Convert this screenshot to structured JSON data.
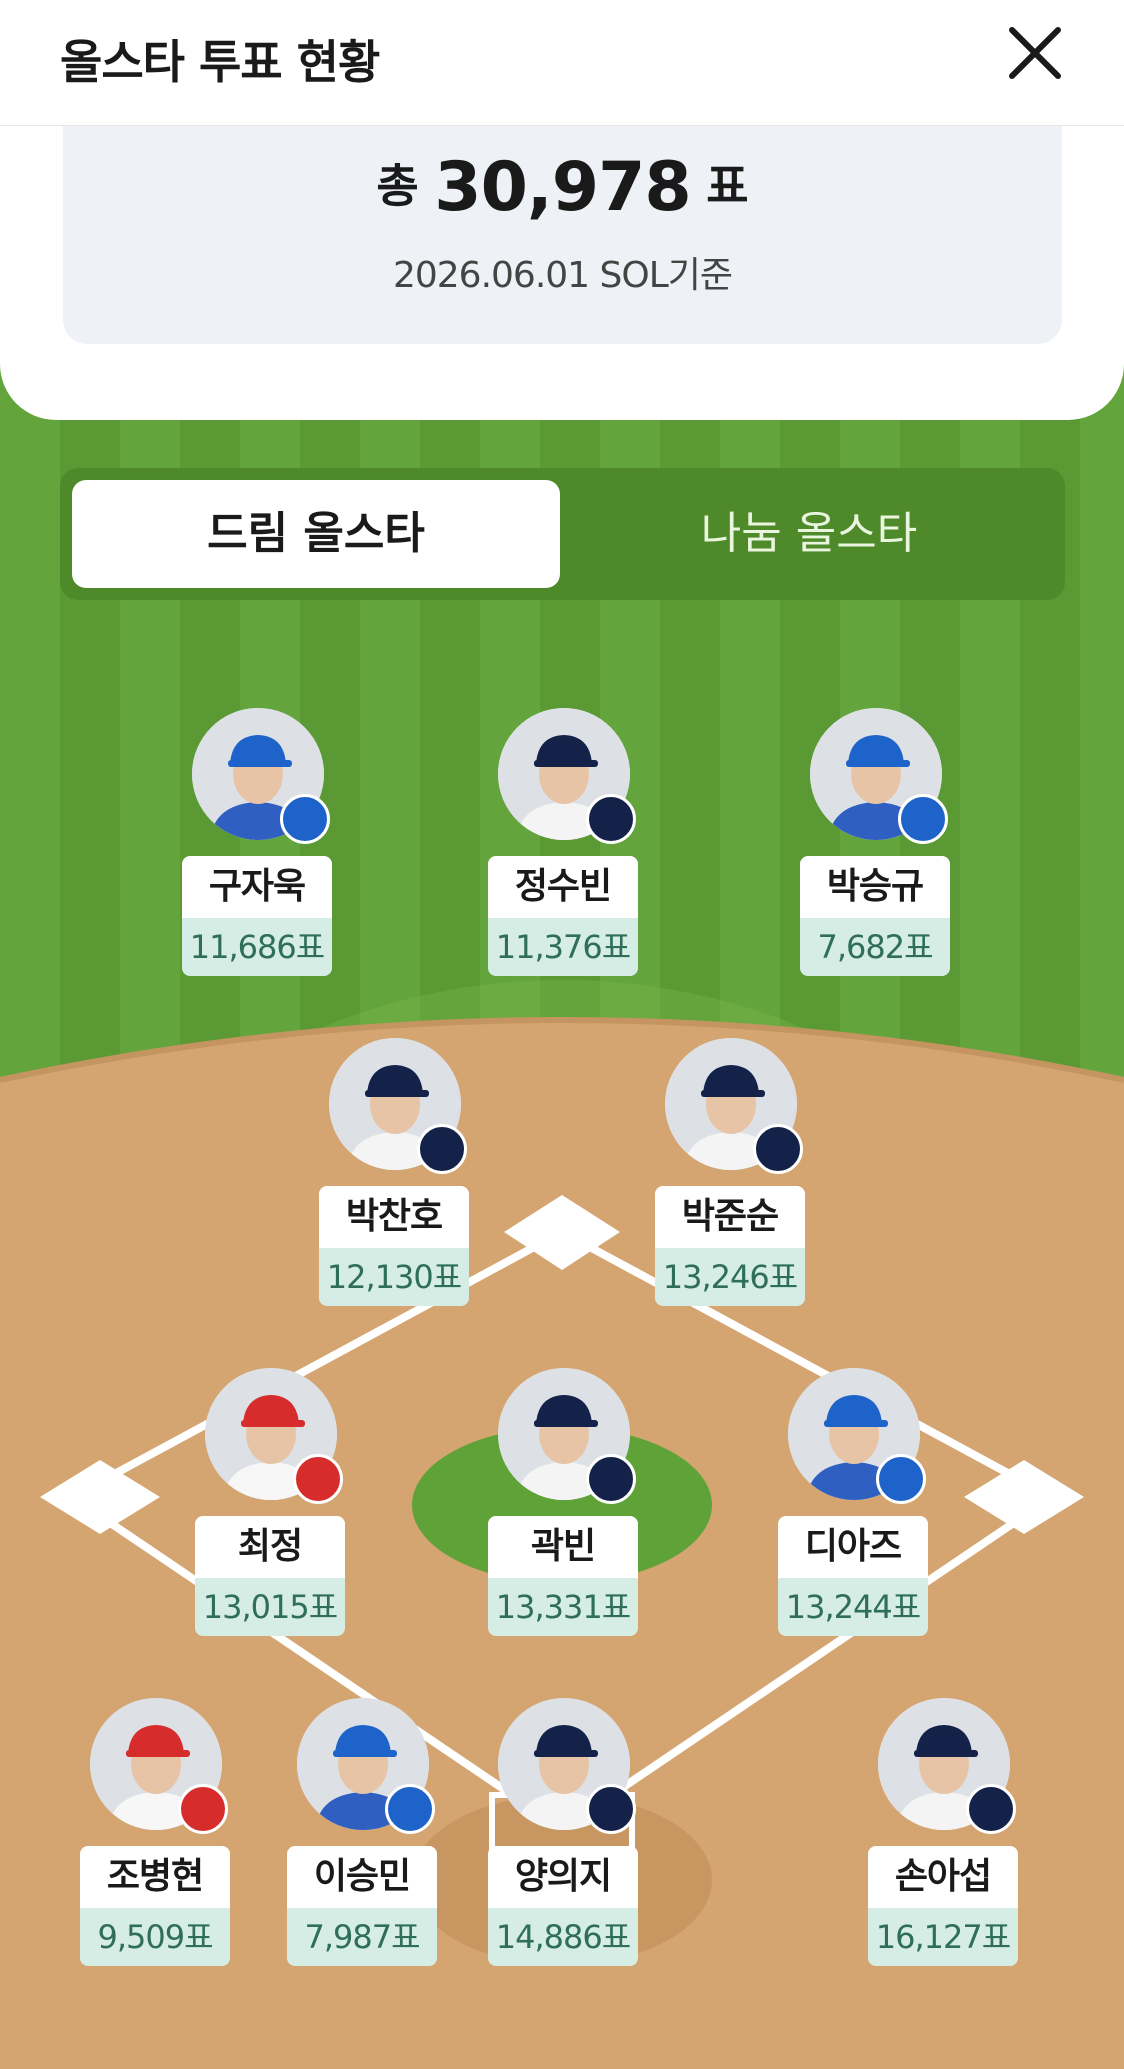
{
  "header": {
    "title": "올스타 투표 현황",
    "close_icon": "close-icon"
  },
  "summary": {
    "total_prefix": "총",
    "total_votes": "30,978",
    "total_unit": "표",
    "basis": "2026.06.01 SOL기준"
  },
  "tabs": [
    {
      "label": "드림 올스타",
      "active": true
    },
    {
      "label": "나눔 올스타",
      "active": false
    }
  ],
  "colors": {
    "grass": "#5f9e38",
    "dirt": "#d4a571",
    "vote_bg": "#d6ede6",
    "vote_text": "#2f6e5a",
    "lions": "#1e63c9",
    "bears": "#14224a",
    "landers": "#d62c2c"
  },
  "players": [
    {
      "name": "구자욱",
      "votes": "11,686표",
      "team": "lions"
    },
    {
      "name": "정수빈",
      "votes": "11,376표",
      "team": "bears"
    },
    {
      "name": "박승규",
      "votes": "7,682표",
      "team": "lions"
    },
    {
      "name": "박찬호",
      "votes": "12,130표",
      "team": "bears"
    },
    {
      "name": "박준순",
      "votes": "13,246표",
      "team": "bears"
    },
    {
      "name": "최정",
      "votes": "13,015표",
      "team": "landers"
    },
    {
      "name": "곽빈",
      "votes": "13,331표",
      "team": "bears"
    },
    {
      "name": "디아즈",
      "votes": "13,244표",
      "team": "lions"
    },
    {
      "name": "조병현",
      "votes": "9,509표",
      "team": "landers"
    },
    {
      "name": "이승민",
      "votes": "7,987표",
      "team": "lions"
    },
    {
      "name": "양의지",
      "votes": "14,886표",
      "team": "bears"
    },
    {
      "name": "손아섭",
      "votes": "16,127표",
      "team": "bears"
    }
  ]
}
